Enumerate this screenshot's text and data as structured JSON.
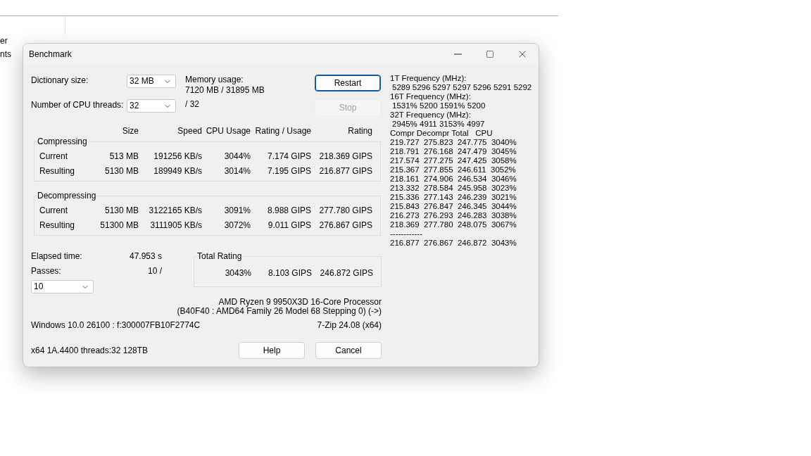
{
  "background": {
    "items": [
      "er",
      "nts"
    ]
  },
  "window": {
    "title": "Benchmark"
  },
  "settings": {
    "dictionary_label": "Dictionary size:",
    "dictionary_value": "32 MB",
    "memory_label": "Memory usage:",
    "memory_value": "7120 MB / 31895 MB",
    "threads_label": "Number of CPU threads:",
    "threads_value": "32",
    "threads_max": "/ 32"
  },
  "buttons": [
    {
      "label": "Restart",
      "disabled": false,
      "default": true
    },
    {
      "label": "Stop",
      "disabled": true,
      "default": false
    }
  ],
  "columns": [
    "Size",
    "Speed",
    "CPU Usage",
    "Rating / Usage",
    "Rating"
  ],
  "groups": [
    {
      "title": "Compressing",
      "rows": [
        {
          "label": "Current",
          "cells": [
            "513 MB",
            "191256 KB/s",
            "3044%",
            "7.174 GIPS",
            "218.369 GIPS"
          ]
        },
        {
          "label": "Resulting",
          "cells": [
            "5130 MB",
            "189949 KB/s",
            "3014%",
            "7.195 GIPS",
            "216.877 GIPS"
          ]
        }
      ]
    },
    {
      "title": "Decompressing",
      "rows": [
        {
          "label": "Current",
          "cells": [
            "5130 MB",
            "3122165 KB/s",
            "3091%",
            "8.988 GIPS",
            "277.780 GIPS"
          ]
        },
        {
          "label": "Resulting",
          "cells": [
            "51300 MB",
            "3111905 KB/s",
            "3072%",
            "9.011 GIPS",
            "276.867 GIPS"
          ]
        }
      ]
    }
  ],
  "elapsed": {
    "label": "Elapsed time:",
    "value": "47.953 s"
  },
  "passes": {
    "label": "Passes:",
    "value": "10 /",
    "select_value": "10"
  },
  "total_rating": {
    "title": "Total Rating",
    "cells": [
      "3043%",
      "8.103 GIPS",
      "246.872 GIPS"
    ]
  },
  "cpu_info": [
    "AMD Ryzen 9 9950X3D 16-Core Processor",
    "(B40F40 : AMD64 Family 26 Model 68 Stepping 0) (->)"
  ],
  "system_info": "Windows 10.0 26100 :  f:300007FB10F2774C",
  "version": "7-Zip 24.08 (x64)",
  "build_info": "x64 1A.4400 threads:32 128TB",
  "footer_buttons": [
    {
      "label": "Help"
    },
    {
      "label": "Cancel"
    }
  ],
  "log": {
    "frequencies": [
      {
        "label": "1T Frequency (MHz):",
        "values": "5289 5296 5297 5297 5296 5291 5292"
      },
      {
        "label": "16T Frequency (MHz):",
        "values": "1531% 5200 1591% 5200"
      },
      {
        "label": "32T Frequency (MHz):",
        "values": "2945% 4911 3153% 4997"
      }
    ],
    "header": "Compr Decompr Total   CPU",
    "rows": [
      "219.727  275.823  247.775  3040%",
      "218.791  276.168  247.479  3045%",
      "217.574  277.275  247.425  3058%",
      "215.367  277.855  246.611  3052%",
      "218.161  274.906  246.534  3046%",
      "213.332  278.584  245.958  3023%",
      "215.336  277.143  246.239  3021%",
      "215.843  276.847  246.345  3044%",
      "216.273  276.293  246.283  3038%",
      "218.369  277.780  248.075  3067%"
    ],
    "separator": "------------",
    "total": "216.877  276.867  246.872  3043%"
  }
}
